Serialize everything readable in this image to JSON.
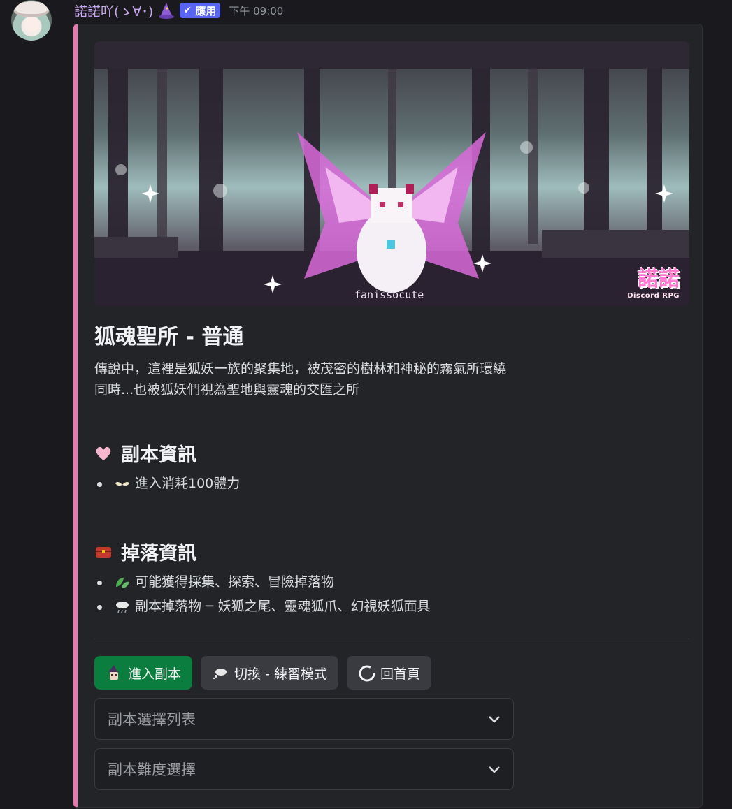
{
  "message": {
    "username": "諾諾吖(ゝ∀･)",
    "app_badge": "應用",
    "timestamp": "下午 09:00"
  },
  "embed": {
    "accent_color": "#e879b0",
    "banner": {
      "credit": "fanissocute",
      "logo_text": "諾諾",
      "logo_sub": "Discord RPG"
    },
    "title": "狐魂聖所 - 普通",
    "description_lines": [
      "傳說中，這裡是狐妖一族的聚集地，被茂密的樹林和神秘的霧氣所環繞",
      "同時...也被狐妖們視為聖地與靈魂的交匯之所"
    ],
    "sections": [
      {
        "heading": "副本資訊",
        "icon": "pink-heart-icon",
        "items": [
          {
            "icon": "wings-icon",
            "text": "進入消耗100體力"
          }
        ]
      },
      {
        "heading": "掉落資訊",
        "icon": "treasure-chest-icon",
        "items": [
          {
            "icon": "leaves-icon",
            "text": "可能獲得採集、探索、冒險掉落物"
          },
          {
            "icon": "rain-cloud-icon",
            "text": "副本掉落物 ─ 妖狐之尾、靈魂狐爪、幻視妖狐面具"
          }
        ]
      }
    ]
  },
  "buttons": [
    {
      "label": "進入副本",
      "icon": "witch-icon",
      "style": "primary",
      "color": "#0b7d3e"
    },
    {
      "label": "切換 - 練習模式",
      "icon": "thought-bubble-icon",
      "style": "secondary"
    },
    {
      "label": "回首頁",
      "icon": "loading-ring-icon",
      "style": "secondary"
    }
  ],
  "selects": [
    {
      "placeholder": "副本選擇列表"
    },
    {
      "placeholder": "副本難度選擇"
    }
  ]
}
